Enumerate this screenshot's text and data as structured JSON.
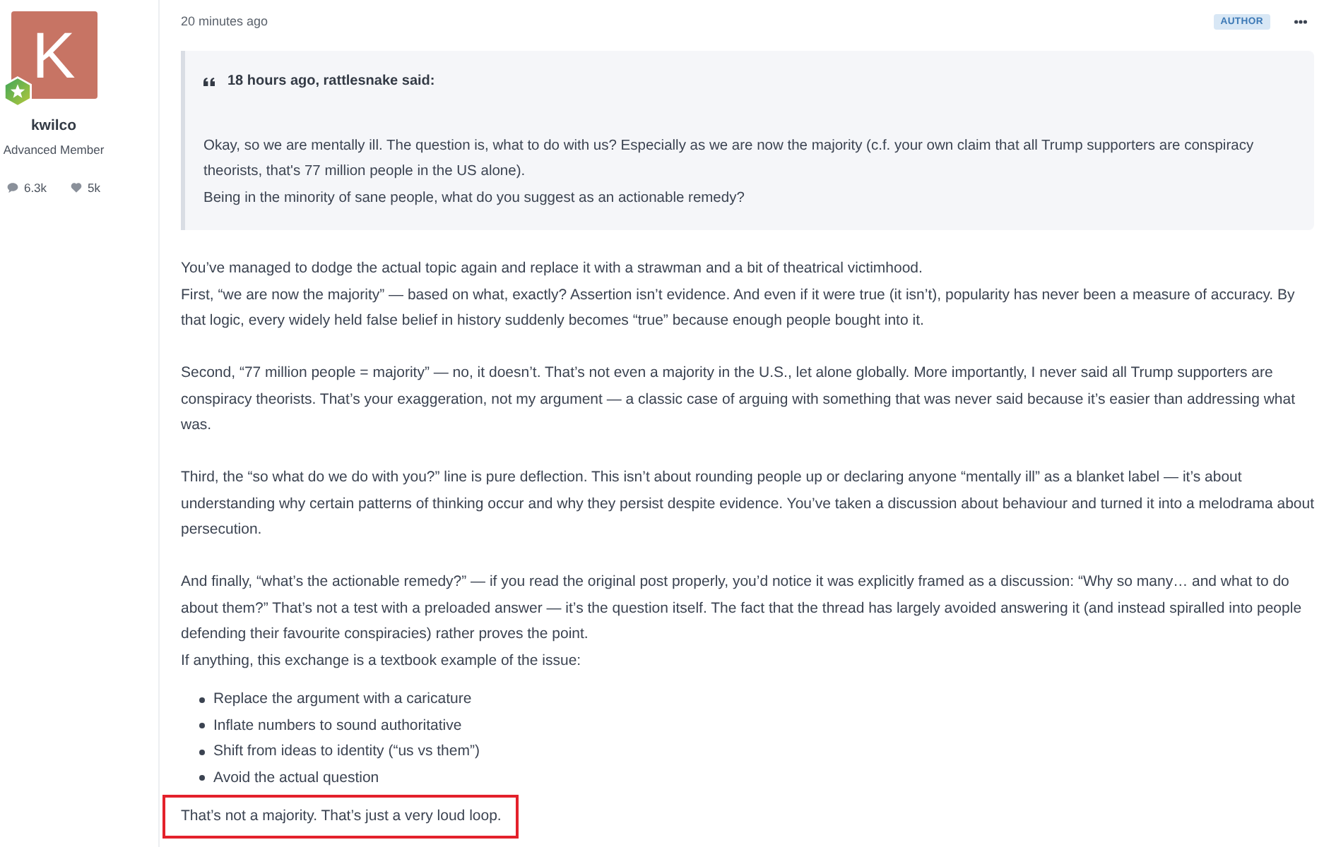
{
  "author": {
    "initial": "K",
    "name": "kwilco",
    "rank": "Advanced Member",
    "stats": [
      {
        "kind": "comments",
        "value": "6.3k"
      },
      {
        "kind": "likes",
        "value": "5k"
      }
    ]
  },
  "post": {
    "time": "20 minutes ago",
    "badge": "AUTHOR",
    "quote": {
      "header": "18 hours ago, rattlesnake said:",
      "lines": [
        "Okay, so we are mentally ill. The question is, what to do with us? Especially as we are now the majority (c.f. your own claim that all Trump supporters are conspiracy theorists, that's 77 million people in the US alone).",
        "Being in the minority of sane people, what do you suggest as an actionable remedy?"
      ]
    },
    "blocks": [
      {
        "kind": "paragraph",
        "highlighted": false,
        "lines": [
          "You’ve managed to dodge the actual topic again and replace it with a strawman and a bit of theatrical victimhood.",
          "First, “we are now the majority” — based on what, exactly? Assertion isn’t evidence. And even if it were true (it isn’t), popularity has never been a measure of accuracy. By that logic, every widely held false belief in history suddenly becomes “true” because enough people bought into it."
        ]
      },
      {
        "kind": "paragraph",
        "highlighted": false,
        "lines": [
          "Second, “77 million people = majority” — no, it doesn’t. That’s not even a majority in the U.S., let alone globally. More importantly, I never said all Trump supporters are conspiracy theorists. That’s your exaggeration, not my argument — a classic case of arguing with something that was never said because it’s easier than addressing what was."
        ]
      },
      {
        "kind": "paragraph",
        "highlighted": false,
        "lines": [
          "Third, the “so what do we do with you?” line is pure deflection. This isn’t about rounding people up or declaring anyone “mentally ill” as a blanket label — it’s about understanding why certain patterns of thinking occur and why they persist despite evidence. You’ve taken a discussion about behaviour and turned it into a melodrama about persecution."
        ]
      },
      {
        "kind": "paragraph",
        "highlighted": false,
        "lines": [
          "And finally, “what’s the actionable remedy?” — if you read the original post properly, you’d notice it was explicitly framed as a discussion: “Why so many… and what to do about them?” That’s not a test with a preloaded answer — it’s the question itself. The fact that the thread has largely avoided answering it (and instead spiralled into people defending their favourite conspiracies) rather proves the point.",
          "If anything, this exchange is a textbook example of the issue:"
        ]
      },
      {
        "kind": "list",
        "items": [
          "Replace the argument with a caricature",
          "Inflate numbers to sound authoritative",
          "Shift from ideas to identity (“us vs them”)",
          "Avoid the actual question"
        ]
      },
      {
        "kind": "paragraph",
        "highlighted": true,
        "lines": [
          "That’s not a majority. That’s just a very loud loop."
        ]
      }
    ]
  }
}
